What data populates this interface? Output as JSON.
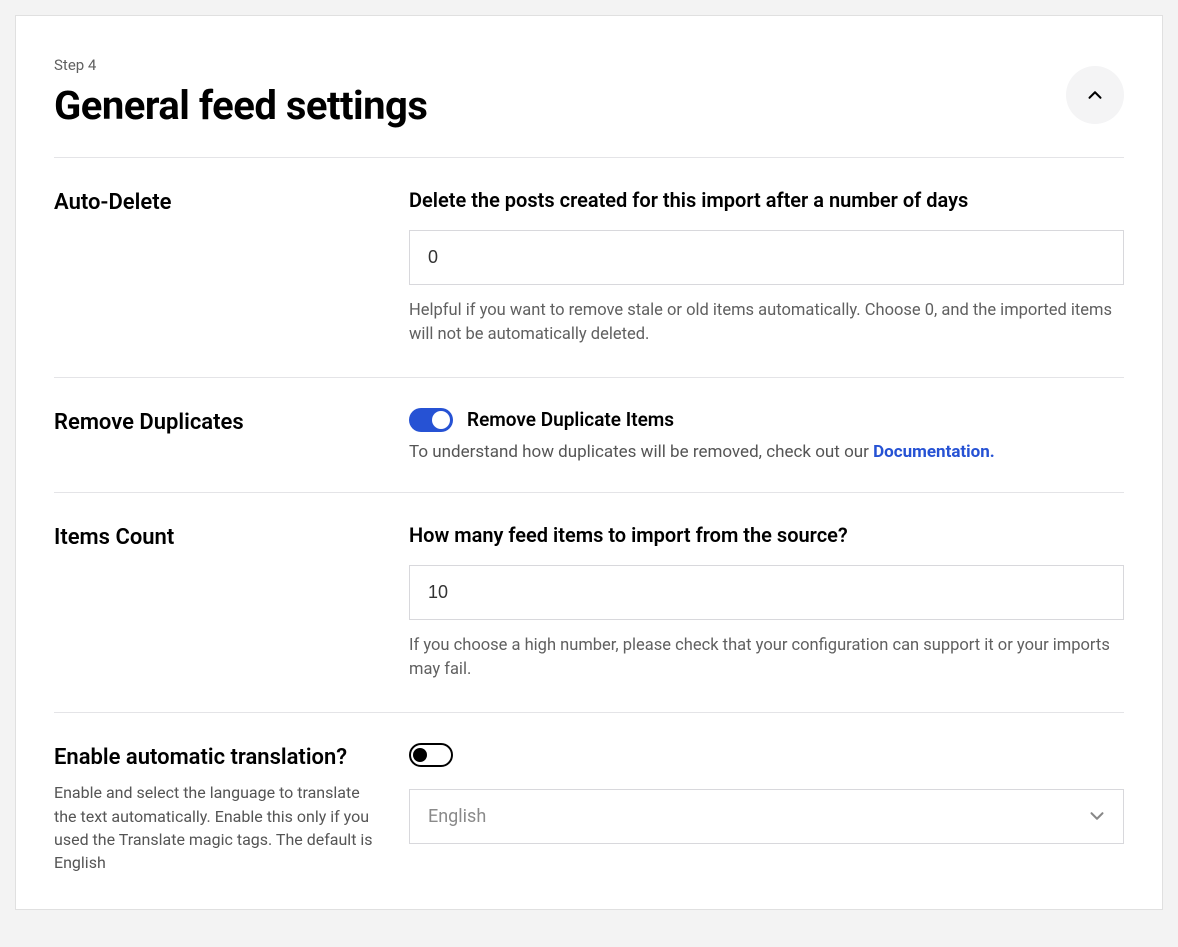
{
  "header": {
    "step": "Step 4",
    "title": "General feed settings"
  },
  "sections": {
    "autoDelete": {
      "label": "Auto-Delete",
      "fieldTitle": "Delete the posts created for this import after a number of days",
      "value": "0",
      "help": "Helpful if you want to remove stale or old items automatically. Choose 0, and the imported items will not be automatically deleted."
    },
    "removeDuplicates": {
      "label": "Remove Duplicates",
      "toggleLabel": "Remove Duplicate Items",
      "toggleOn": true,
      "docPrefix": "To understand how duplicates will be removed, check out our ",
      "docLink": "Documentation."
    },
    "itemsCount": {
      "label": "Items Count",
      "fieldTitle": "How many feed items to import from the source?",
      "value": "10",
      "help": "If you choose a high number, please check that your configuration can support it or your imports may fail."
    },
    "translation": {
      "label": "Enable automatic translation?",
      "subtext": "Enable and select the language to translate the text automatically. Enable this only if you used the Translate magic tags. The default is English",
      "toggleOn": false,
      "selectValue": "English"
    }
  }
}
